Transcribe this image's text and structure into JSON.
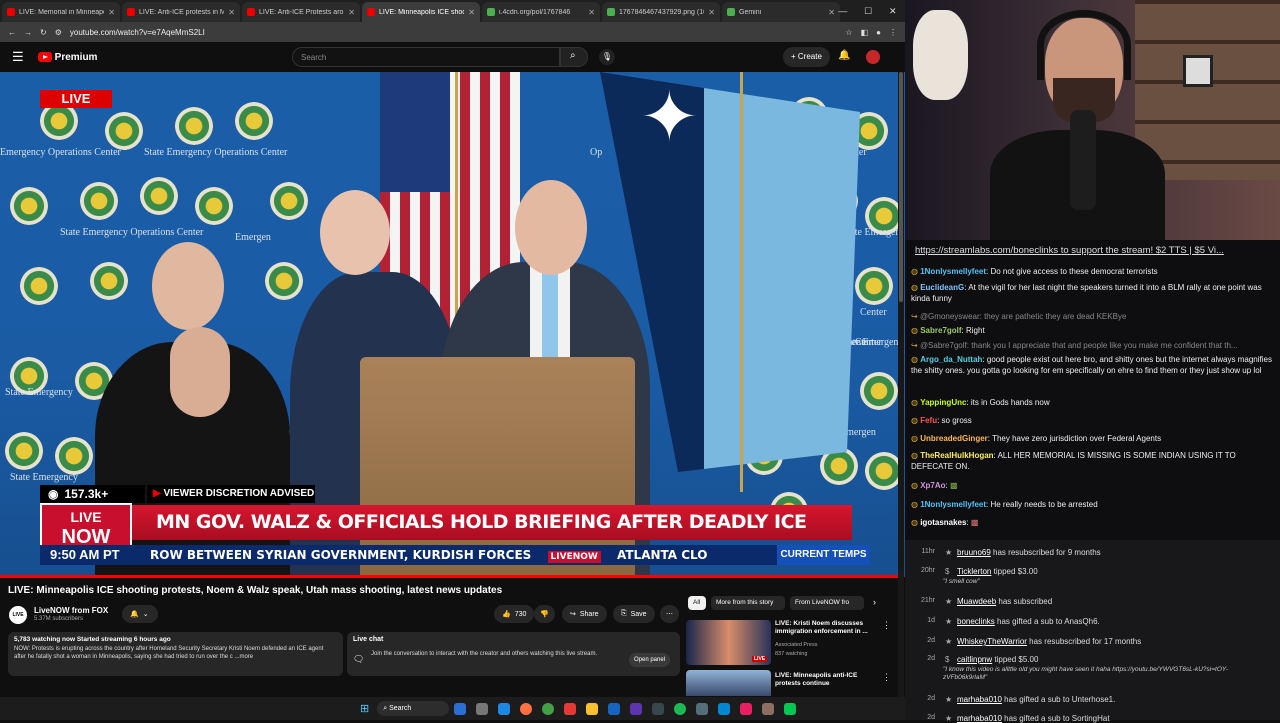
{
  "browser": {
    "tabs": [
      {
        "label": "LIVE: Memorial in Minneapolis",
        "active": false
      },
      {
        "label": "LIVE: Anti-ICE protests in Minn",
        "active": false
      },
      {
        "label": "LIVE: Anti-ICE Protests aro",
        "active": false
      },
      {
        "label": "LIVE: Minneapolis ICE shoo",
        "active": true
      },
      {
        "label": "i.4cdn.org/pol/1767846",
        "active": false
      },
      {
        "label": "1767846467437929.png (100",
        "active": false
      },
      {
        "label": "Gemini",
        "active": false
      }
    ],
    "url": "youtube.com/watch?v=e7AqeMmS2LI"
  },
  "youtube": {
    "brand": "Premium",
    "search_placeholder": "Search",
    "create_label": "Create"
  },
  "video": {
    "live_badge": "LIVE",
    "backdrop_text": [
      "State Emergency Operations Center",
      "State Emergency Operations Center",
      "Emergency Operations Center",
      "Emergen",
      "Center",
      "State Emergen",
      "State Emergenc",
      "Emergen",
      "Op",
      "Center",
      "Center",
      "Center",
      "State Emergency",
      "State Emergency"
    ],
    "viewers": "157.3k+",
    "discretion": "VIEWER DISCRETION ADVISED",
    "live_now_1": "LIVE",
    "live_now_2": "NOW",
    "headline": "MN GOV. WALZ & OFFICIALS HOLD BRIEFING AFTER DEADLY ICE SHOOTING",
    "time": "9:50 AM PT",
    "ticker": "ROW BETWEEN SYRIAN GOVERNMENT, KURDISH FORCES",
    "ticker_logo": "LIVENOW",
    "ticker_2": "ATLANTA CLO",
    "current_temps": "CURRENT TEMPS"
  },
  "watch": {
    "title": "LIVE: Minneapolis ICE shooting protests, Noem & Walz speak, Utah mass shooting, latest news updates",
    "channel": "LiveNOW from FOX",
    "subscribers": "5.37M subscribers",
    "likes": "730",
    "share": "Share",
    "save": "Save",
    "meta": "5,783 watching now  Started streaming 6 hours ago",
    "description": "NOW: Protests is erupting across the country after Homeland Security Secretary Kristi Noem defended an ICE agent after he fatally shot a woman in Minneapolis, saying she had tried to run over the c ...more",
    "live_chat_title": "Live chat",
    "live_chat_text": "Join the conversation to interact with the creator and others watching this live stream.",
    "open_panel": "Open panel",
    "chips": [
      "All",
      "More from this story",
      "From LiveNOW fro"
    ],
    "related": [
      {
        "title": "LIVE: Kristi Noem discusses immigration enforcement in ...",
        "channel": "Associated Press",
        "meta": "837 watching",
        "badge": "LIVE"
      },
      {
        "title": "LIVE: Minneapolis anti-ICE protests continue",
        "channel": "",
        "meta": "",
        "badge": ""
      }
    ]
  },
  "stream_chat": {
    "banner": "https://streamlabs.com/boneclinks to support the stream! $2 TTS | $5 Vi...",
    "messages": [
      {
        "user": "1Nonlysmellyfeet",
        "color": "#4fc3f7",
        "text": "Do not give access to these democrat terrorists"
      },
      {
        "user": "EuclideanG",
        "color": "#7cc4ff",
        "text": "At the vigil for her last night the speakers turned it into a BLM rally at one point was kinda funny"
      },
      {
        "user": "",
        "color": "#888888",
        "text": "@Gmoneyswear: they are pathetic they are dead KEKBye"
      },
      {
        "user": "Sabre7golf",
        "color": "#9ccc65",
        "text": "Right"
      },
      {
        "user": "",
        "color": "#888888",
        "text": "@Sabre7golf: thank you I appreciate that and people like you make me confident that th..."
      },
      {
        "user": "Argo_da_Nuttah",
        "color": "#4dd0e1",
        "text": "good people exist out here bro, and shitty ones but the internet always magnifies the shitty ones. you gotta go looking for em specifically on ehre to find them or they just show up lol"
      },
      {
        "user": "YappingUnc",
        "color": "#c6ff00",
        "text": "its in Gods hands now"
      },
      {
        "user": "Fefu",
        "color": "#ff5252",
        "text": "so gross"
      },
      {
        "user": "UnbreadedGinger",
        "color": "#ffb74d",
        "text": "They have zero jurisdiction over Federal Agents"
      },
      {
        "user": "TheRealHulkHogan",
        "color": "#ffee58",
        "text": "ALL HER MEMORIAL IS MISSING IS SOME INDIAN USING IT TO DEFECATE ON."
      },
      {
        "user": "Xp7Ao",
        "color": "#ce93d8",
        "text": ""
      },
      {
        "user": "1Nonlysmellyfeet",
        "color": "#4fc3f7",
        "text": "He really needs to be arrested"
      },
      {
        "user": "igotasnakes",
        "color": "#ffffff",
        "text": ""
      }
    ]
  },
  "events": [
    {
      "time": "11hr",
      "icon": "sub",
      "name": "bruuno69",
      "text": " has resubscribed for 9 months",
      "sub": ""
    },
    {
      "time": "20hr",
      "icon": "tip",
      "name": "Ticklerton",
      "text": " tipped $3.00",
      "sub": "\"I smell cow\""
    },
    {
      "time": "21hr",
      "icon": "sub",
      "name": "Muawdeeb",
      "text": " has subscribed",
      "sub": ""
    },
    {
      "time": "1d",
      "icon": "sub",
      "name": "boneclinks",
      "text": " has gifted a sub to AnasQh6.",
      "sub": ""
    },
    {
      "time": "2d",
      "icon": "sub",
      "name": "WhiskeyTheWarrior",
      "text": " has resubscribed for 17 months",
      "sub": ""
    },
    {
      "time": "2d",
      "icon": "tip",
      "name": "caitlinpnw",
      "text": " tipped $5.00",
      "sub": "\"I know this video is alittle old you might have seen it haha https://youtu.be/YWVGT6sL-kU?si=tOY-zVFb06k9rlaM\""
    },
    {
      "time": "2d",
      "icon": "sub",
      "name": "marhaba010",
      "text": " has gifted a sub to Unterhose1.",
      "sub": ""
    },
    {
      "time": "2d",
      "icon": "sub",
      "name": "marhaba010",
      "text": " has gifted a sub to SortingHat",
      "sub": ""
    }
  ],
  "taskbar": {
    "search": "Search"
  },
  "colors": {
    "yt_red": "#ff0000",
    "chyron_red": "#c8102e",
    "chyron_blue": "#0b2a6b"
  }
}
